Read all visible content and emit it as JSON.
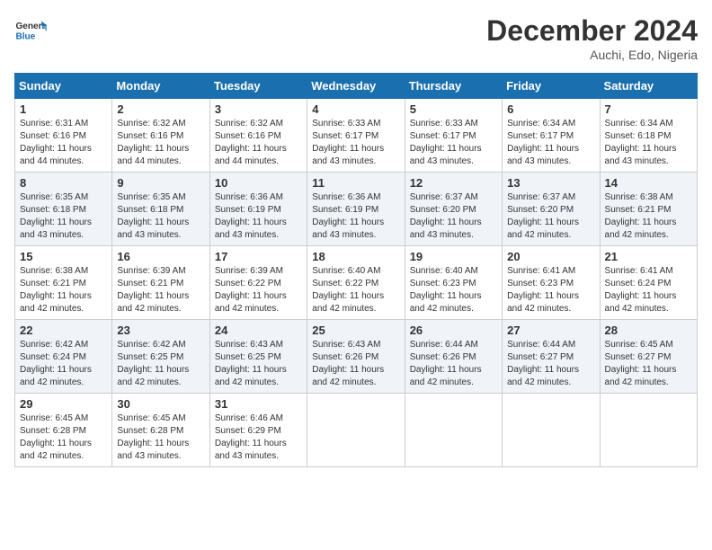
{
  "header": {
    "logo_line1": "General",
    "logo_line2": "Blue",
    "month_title": "December 2024",
    "subtitle": "Auchi, Edo, Nigeria"
  },
  "days_of_week": [
    "Sunday",
    "Monday",
    "Tuesday",
    "Wednesday",
    "Thursday",
    "Friday",
    "Saturday"
  ],
  "weeks": [
    [
      {
        "day": "1",
        "sunrise": "6:31 AM",
        "sunset": "6:16 PM",
        "daylight": "11 hours and 44 minutes."
      },
      {
        "day": "2",
        "sunrise": "6:32 AM",
        "sunset": "6:16 PM",
        "daylight": "11 hours and 44 minutes."
      },
      {
        "day": "3",
        "sunrise": "6:32 AM",
        "sunset": "6:16 PM",
        "daylight": "11 hours and 44 minutes."
      },
      {
        "day": "4",
        "sunrise": "6:33 AM",
        "sunset": "6:17 PM",
        "daylight": "11 hours and 43 minutes."
      },
      {
        "day": "5",
        "sunrise": "6:33 AM",
        "sunset": "6:17 PM",
        "daylight": "11 hours and 43 minutes."
      },
      {
        "day": "6",
        "sunrise": "6:34 AM",
        "sunset": "6:17 PM",
        "daylight": "11 hours and 43 minutes."
      },
      {
        "day": "7",
        "sunrise": "6:34 AM",
        "sunset": "6:18 PM",
        "daylight": "11 hours and 43 minutes."
      }
    ],
    [
      {
        "day": "8",
        "sunrise": "6:35 AM",
        "sunset": "6:18 PM",
        "daylight": "11 hours and 43 minutes."
      },
      {
        "day": "9",
        "sunrise": "6:35 AM",
        "sunset": "6:18 PM",
        "daylight": "11 hours and 43 minutes."
      },
      {
        "day": "10",
        "sunrise": "6:36 AM",
        "sunset": "6:19 PM",
        "daylight": "11 hours and 43 minutes."
      },
      {
        "day": "11",
        "sunrise": "6:36 AM",
        "sunset": "6:19 PM",
        "daylight": "11 hours and 43 minutes."
      },
      {
        "day": "12",
        "sunrise": "6:37 AM",
        "sunset": "6:20 PM",
        "daylight": "11 hours and 43 minutes."
      },
      {
        "day": "13",
        "sunrise": "6:37 AM",
        "sunset": "6:20 PM",
        "daylight": "11 hours and 42 minutes."
      },
      {
        "day": "14",
        "sunrise": "6:38 AM",
        "sunset": "6:21 PM",
        "daylight": "11 hours and 42 minutes."
      }
    ],
    [
      {
        "day": "15",
        "sunrise": "6:38 AM",
        "sunset": "6:21 PM",
        "daylight": "11 hours and 42 minutes."
      },
      {
        "day": "16",
        "sunrise": "6:39 AM",
        "sunset": "6:21 PM",
        "daylight": "11 hours and 42 minutes."
      },
      {
        "day": "17",
        "sunrise": "6:39 AM",
        "sunset": "6:22 PM",
        "daylight": "11 hours and 42 minutes."
      },
      {
        "day": "18",
        "sunrise": "6:40 AM",
        "sunset": "6:22 PM",
        "daylight": "11 hours and 42 minutes."
      },
      {
        "day": "19",
        "sunrise": "6:40 AM",
        "sunset": "6:23 PM",
        "daylight": "11 hours and 42 minutes."
      },
      {
        "day": "20",
        "sunrise": "6:41 AM",
        "sunset": "6:23 PM",
        "daylight": "11 hours and 42 minutes."
      },
      {
        "day": "21",
        "sunrise": "6:41 AM",
        "sunset": "6:24 PM",
        "daylight": "11 hours and 42 minutes."
      }
    ],
    [
      {
        "day": "22",
        "sunrise": "6:42 AM",
        "sunset": "6:24 PM",
        "daylight": "11 hours and 42 minutes."
      },
      {
        "day": "23",
        "sunrise": "6:42 AM",
        "sunset": "6:25 PM",
        "daylight": "11 hours and 42 minutes."
      },
      {
        "day": "24",
        "sunrise": "6:43 AM",
        "sunset": "6:25 PM",
        "daylight": "11 hours and 42 minutes."
      },
      {
        "day": "25",
        "sunrise": "6:43 AM",
        "sunset": "6:26 PM",
        "daylight": "11 hours and 42 minutes."
      },
      {
        "day": "26",
        "sunrise": "6:44 AM",
        "sunset": "6:26 PM",
        "daylight": "11 hours and 42 minutes."
      },
      {
        "day": "27",
        "sunrise": "6:44 AM",
        "sunset": "6:27 PM",
        "daylight": "11 hours and 42 minutes."
      },
      {
        "day": "28",
        "sunrise": "6:45 AM",
        "sunset": "6:27 PM",
        "daylight": "11 hours and 42 minutes."
      }
    ],
    [
      {
        "day": "29",
        "sunrise": "6:45 AM",
        "sunset": "6:28 PM",
        "daylight": "11 hours and 42 minutes."
      },
      {
        "day": "30",
        "sunrise": "6:45 AM",
        "sunset": "6:28 PM",
        "daylight": "11 hours and 43 minutes."
      },
      {
        "day": "31",
        "sunrise": "6:46 AM",
        "sunset": "6:29 PM",
        "daylight": "11 hours and 43 minutes."
      },
      null,
      null,
      null,
      null
    ]
  ]
}
